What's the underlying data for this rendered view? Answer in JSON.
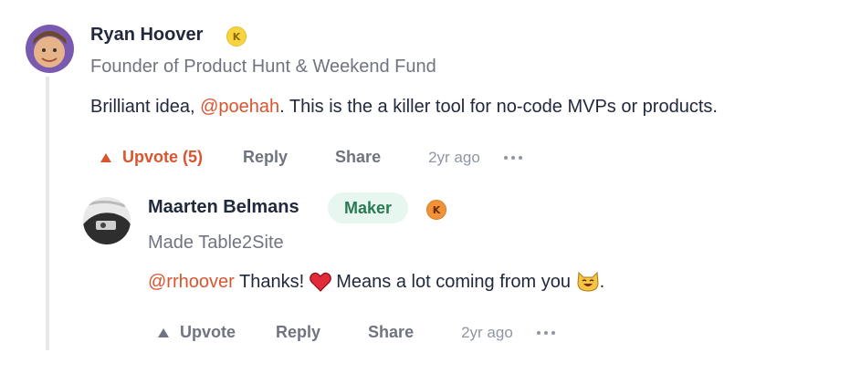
{
  "comment": {
    "author": "Ryan Hoover",
    "karma": "K",
    "headline": "Founder of Product Hunt & Weekend Fund",
    "body_prefix": "Brilliant idea, ",
    "mention": "@poehah",
    "body_suffix": ". This is the a killer tool for no-code MVPs or products.",
    "actions": {
      "upvote_label": "Upvote (5)",
      "reply_label": "Reply",
      "share_label": "Share",
      "timestamp": "2yr ago"
    }
  },
  "reply": {
    "author": "Maarten Belmans",
    "badge": "Maker",
    "karma": "K",
    "headline": "Made Table2Site",
    "mention": "@rrhoover",
    "text_1": " Thanks! ",
    "text_2": " Means a lot coming from you ",
    "text_3": ".",
    "actions": {
      "upvote_label": "Upvote",
      "reply_label": "Reply",
      "share_label": "Share",
      "timestamp": "2yr ago"
    }
  },
  "colors": {
    "accent": "#da552f",
    "maker_badge_bg": "#e7f6ef",
    "maker_badge_text": "#2a7a53"
  }
}
